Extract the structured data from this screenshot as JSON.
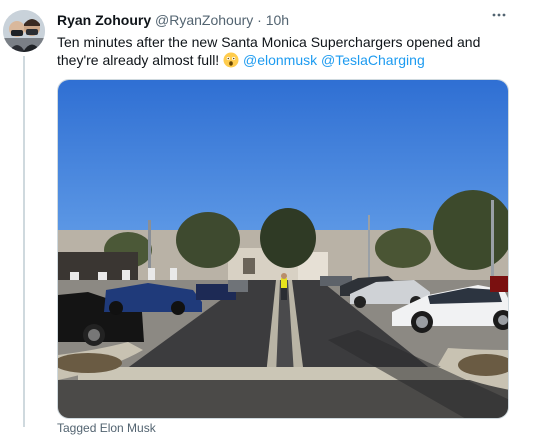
{
  "tweet": {
    "author_name": "Ryan Zohoury",
    "handle": "@RyanZohoury",
    "separator": "·",
    "time": "10h",
    "more_icon": "more-horizontal-icon",
    "text": "Ten minutes after the new Santa Monica Superchargers opened and they're already almost full!",
    "emoji": "astonished-face-emoji",
    "mentions": [
      "@elonmusk",
      "@TeslaCharging"
    ],
    "footer": "Tagged Elon Musk"
  },
  "colors": {
    "link": "#1d9bf0",
    "thread_line": "#cfd9de",
    "secondary_text": "#536471"
  }
}
